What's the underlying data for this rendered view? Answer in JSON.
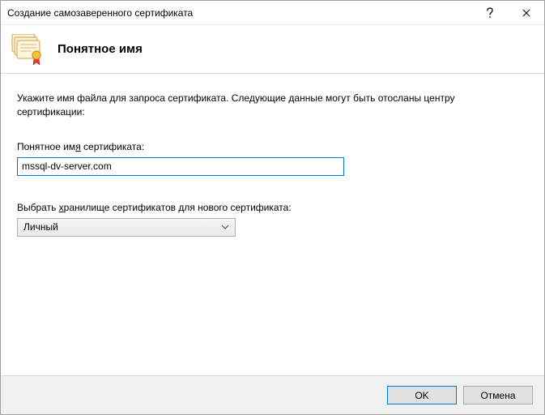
{
  "titlebar": {
    "title": "Создание самозаверенного сертификата"
  },
  "header": {
    "heading": "Понятное имя"
  },
  "body": {
    "instruction": "Укажите имя файла для запроса сертификата. Следующие данные могут быть отосланы центру сертификации:",
    "cert_name": {
      "label_pre": "Понятное им",
      "label_ul": "я",
      "label_post": " сертификата:",
      "value": "mssql-dv-server.com"
    },
    "store": {
      "label_pre": "Выбрать ",
      "label_ul": "х",
      "label_post": "ранилище сертификатов для нового сертификата:",
      "selected": "Личный"
    }
  },
  "footer": {
    "ok": "OK",
    "cancel": "Отмена"
  }
}
